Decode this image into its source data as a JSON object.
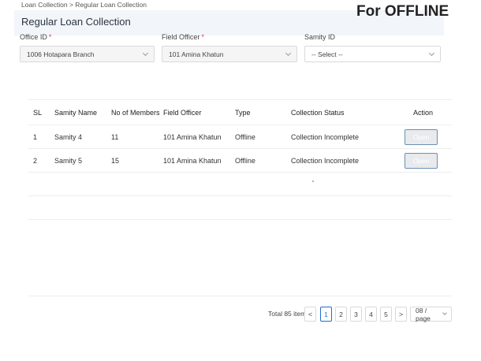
{
  "breadcrumb": "Loan Collection > Regular Loan Collection",
  "page_title": "Regular Loan Collection",
  "mode_banner": "For OFFLINE",
  "filters": {
    "office": {
      "label": "Office ID",
      "required_mark": "*",
      "value": "1006 Hotapara Branch"
    },
    "officer": {
      "label": "Field Officer",
      "required_mark": "*",
      "value": "101 Amina Khatun"
    },
    "samity": {
      "label": "Samity ID",
      "value": "-- Select --"
    }
  },
  "table": {
    "headers": {
      "sl": "SL",
      "name": "Samity Name",
      "members": "No of Members",
      "officer": "Field Officer",
      "type": "Type",
      "status": "Collection Status",
      "action": "Action"
    },
    "rows": [
      {
        "sl": "1",
        "name": "Samity 4",
        "members": "11",
        "officer": "101 Amina Khatun",
        "type": "Offline",
        "status": "Collection Incomplete",
        "action": "Open"
      },
      {
        "sl": "2",
        "name": "Samity 5",
        "members": "15",
        "officer": "101 Amina Khatun",
        "type": "Offline",
        "status": "Collection Incomplete",
        "action": "Open"
      }
    ]
  },
  "pagination": {
    "total": "Total 85 items",
    "prev": "<",
    "pages": [
      "1",
      "2",
      "3",
      "4",
      "5"
    ],
    "next": ">",
    "current": "1",
    "page_size": "08 / page"
  }
}
